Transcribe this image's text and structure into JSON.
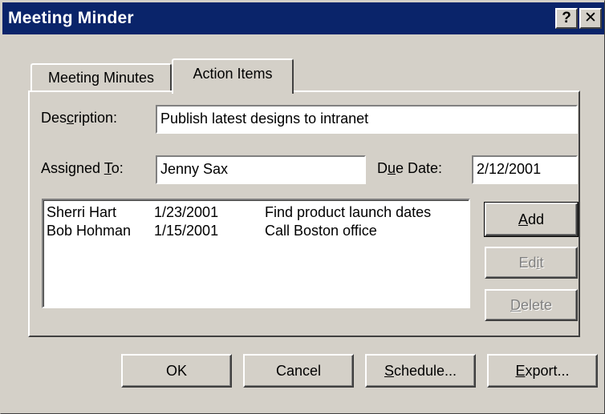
{
  "window": {
    "title": "Meeting Minder",
    "help_btn": "?",
    "close_btn": "✕"
  },
  "tabs": [
    {
      "label": "Meeting Minutes",
      "selected": false
    },
    {
      "label": "Action Items",
      "selected": true
    }
  ],
  "form": {
    "description": {
      "label_pre": "Des",
      "label_key": "c",
      "label_post": "ription:",
      "value": "Publish latest designs to intranet"
    },
    "assigned_to": {
      "label_pre": "Assigned ",
      "label_key": "T",
      "label_post": "o:",
      "value": "Jenny Sax"
    },
    "due_date": {
      "label_pre": "D",
      "label_key": "u",
      "label_post": "e Date:",
      "value": "2/12/2001"
    }
  },
  "action_items": [
    {
      "person": "Sherri Hart",
      "date": "1/23/2001",
      "task": "Find product launch dates"
    },
    {
      "person": "Bob Hohman",
      "date": "1/15/2001",
      "task": "Call Boston office"
    }
  ],
  "side_buttons": {
    "add": {
      "pre": "",
      "key": "A",
      "post": "dd"
    },
    "edit": {
      "pre": "Ed",
      "key": "i",
      "post": "t"
    },
    "delete": {
      "pre": "",
      "key": "D",
      "post": "elete"
    }
  },
  "footer_buttons": {
    "ok": "OK",
    "cancel": "Cancel",
    "schedule": {
      "key": "S",
      "post": "chedule..."
    },
    "export": {
      "key": "E",
      "post": "xport..."
    }
  }
}
